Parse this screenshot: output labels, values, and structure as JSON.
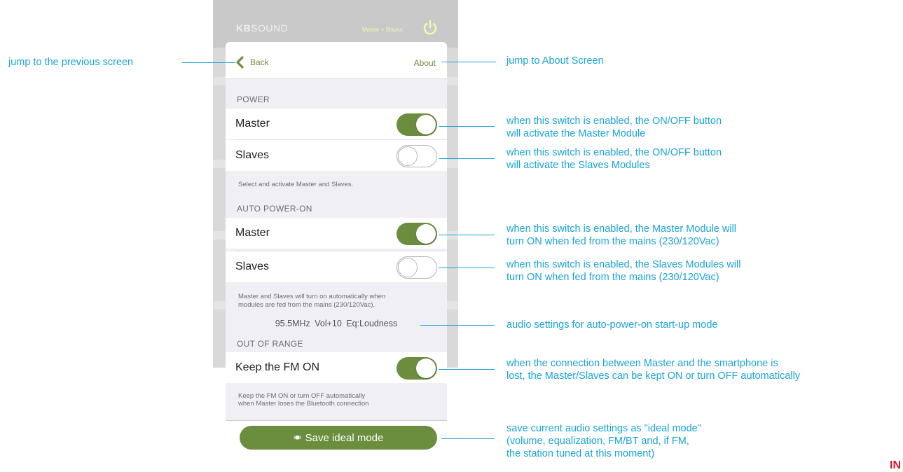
{
  "app": {
    "brand_bold": "KB",
    "brand_rest": "SOUND",
    "mode_label": "Master + Slaves"
  },
  "nav": {
    "back_label": "Back",
    "about_label": "About"
  },
  "power": {
    "section_title": "POWER",
    "master_label": "Master",
    "master_on": true,
    "slaves_label": "Slaves",
    "slaves_on": false,
    "note": "Select and activate Master and Slaves."
  },
  "auto_power": {
    "section_title": "AUTO POWER-ON",
    "master_label": "Master",
    "master_on": true,
    "slaves_label": "Slaves",
    "slaves_on": false,
    "note_line1": "Master and Slaves will turn on automatically when",
    "note_line2": "modules are fed from the mains (230/120Vac).",
    "audio_settings": "95.5MHz  Vol+10  Eq:Loudness"
  },
  "out_of_range": {
    "section_title": "OUT OF RANGE",
    "keep_fm_label": "Keep the FM  ON",
    "keep_fm_on": true,
    "note_line1": "Keep the FM  ON or turn OFF automatically",
    "note_line2": "when Master loses the Bluetooth connection"
  },
  "save": {
    "label": "Save ideal mode",
    "icon": "›■‹"
  },
  "annotations": {
    "back": "jump to the previous screen",
    "about": "jump to About Screen",
    "power_master_1": "when this switch is enabled, the ON/OFF button",
    "power_master_2": "will activate the Master Module",
    "power_slaves_1": "when this switch is enabled, the ON/OFF button",
    "power_slaves_2": "will activate the Slaves Modules",
    "auto_master_1": "when this switch is enabled, the Master Module will",
    "auto_master_2": "turn ON when fed from the mains (230/120Vac)",
    "auto_slaves_1": "when this switch is enabled, the Slaves Modules will",
    "auto_slaves_2": "turn ON when fed from the mains (230/120Vac)",
    "audio": "audio settings for auto-power-on start-up mode",
    "fm_1": "when the connection between Master and the smartphone is",
    "fm_2": "lost, the Master/Slaves can be kept ON or turn OFF automatically",
    "save_1": "save current audio settings as \"ideal mode\"",
    "save_2": "(volume, equalization, FM/BT and, if FM,",
    "save_3": "the station tuned at this moment)"
  },
  "corner_mark": "IN",
  "colors": {
    "accent_green": "#6a8e3e",
    "annotation_blue": "#1aa3d9"
  }
}
